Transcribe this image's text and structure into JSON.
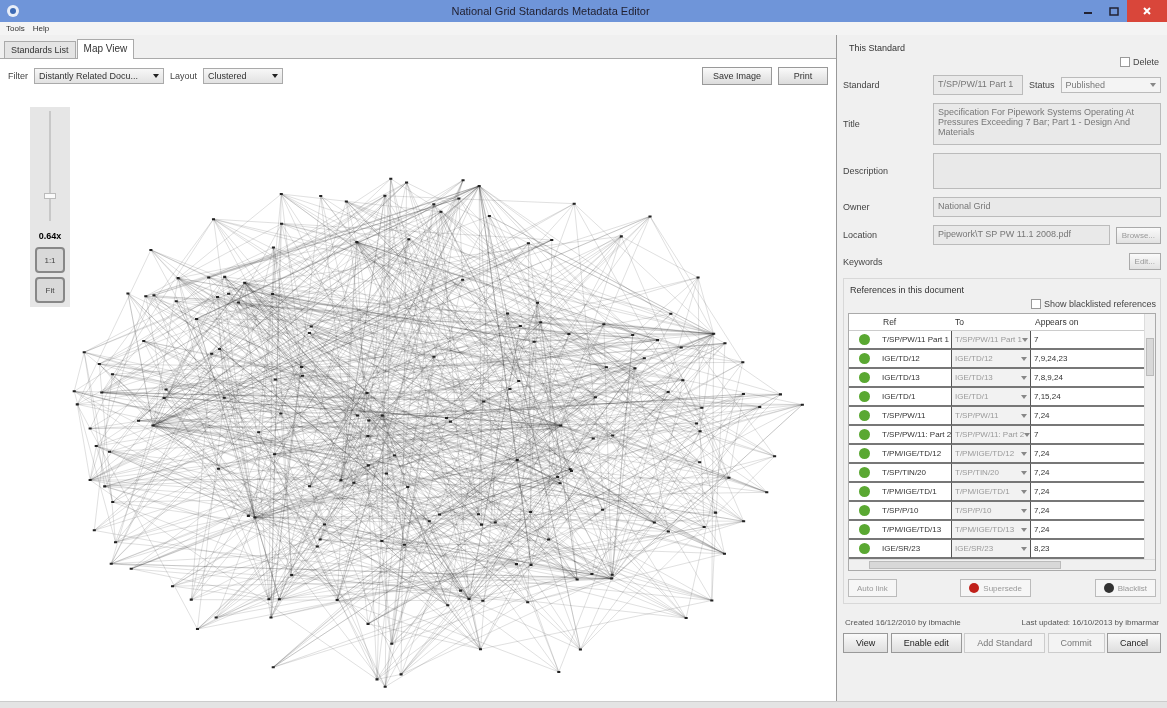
{
  "window": {
    "title": "National Grid Standards Metadata Editor"
  },
  "menu": [
    "Tools",
    "Help"
  ],
  "tabs": [
    {
      "label": "Standards List",
      "selected": false
    },
    {
      "label": "Map View",
      "selected": true
    }
  ],
  "map_toolbar": {
    "filter_label": "Filter",
    "filter_value": "Distantly Related Docu...",
    "layout_label": "Layout",
    "layout_value": "Clustered",
    "buttons": [
      "Save Image",
      "Print"
    ]
  },
  "zoom": {
    "level": 0.2,
    "reading": "0.64x",
    "buttons": [
      "1:1",
      "Fit"
    ]
  },
  "standard": {
    "group_title": "This Standard",
    "delete": {
      "label": "Delete",
      "checked": false
    },
    "fields": [
      {
        "label": "Standard",
        "value": "T/SP/PW/11 Part 1"
      },
      {
        "label": "Title",
        "value": "Specification For Pipework Systems Operating At Pressures Exceeding 7 Bar; Part 1 - Design And Materials"
      },
      {
        "label": "Description"
      },
      {
        "label": "Owner",
        "value": "National Grid"
      },
      {
        "label": "Location",
        "value": "Pipework\\T SP PW 11.1 2008.pdf"
      },
      {
        "label": "Keywords"
      }
    ],
    "status_label": "Status",
    "status_value": "Published",
    "browse_button": "Browse...",
    "edit_button": "Edit..."
  },
  "references": {
    "group_title": "References in this document",
    "show_blacklisted": {
      "label": "Show blacklisted references",
      "checked": false
    },
    "columns": [
      "Ref",
      "To",
      "Appears on"
    ],
    "rows": [
      {
        "color": "#5aa832",
        "ref": "T/SP/PW/11 Part 1",
        "to": "T/SP/PW/11 Part 1",
        "appears": "7"
      },
      {
        "color": "#5aa832",
        "ref": "IGE/TD/12",
        "to": "IGE/TD/12",
        "appears": "7,9,24,23"
      },
      {
        "color": "#5aa832",
        "ref": "IGE/TD/13",
        "to": "IGE/TD/13",
        "appears": "7,8,9,24"
      },
      {
        "color": "#5aa832",
        "ref": "IGE/TD/1",
        "to": "IGE/TD/1",
        "appears": "7,15,24"
      },
      {
        "color": "#5aa832",
        "ref": "T/SP/PW/11",
        "to": "T/SP/PW/11",
        "appears": "7,24"
      },
      {
        "color": "#5aa832",
        "ref": "T/SP/PW/11: Part 2",
        "to": "T/SP/PW/11: Part 2",
        "appears": "7"
      },
      {
        "color": "#5aa832",
        "ref": "T/PM/IGE/TD/12",
        "to": "T/PM/IGE/TD/12",
        "appears": "7,24"
      },
      {
        "color": "#5aa832",
        "ref": "T/SP/TIN/20",
        "to": "T/SP/TIN/20",
        "appears": "7,24"
      },
      {
        "color": "#5aa832",
        "ref": "T/PM/IGE/TD/1",
        "to": "T/PM/IGE/TD/1",
        "appears": "7,24"
      },
      {
        "color": "#5aa832",
        "ref": "T/SP/P/10",
        "to": "T/SP/P/10",
        "appears": "7,24"
      },
      {
        "color": "#5aa832",
        "ref": "T/PM/IGE/TD/13",
        "to": "T/PM/IGE/TD/13",
        "appears": "7,24"
      },
      {
        "color": "#5aa832",
        "ref": "IGE/SR/23",
        "to": "IGE/SR/23",
        "appears": "8,23"
      }
    ],
    "actions": [
      {
        "label": "Auto link",
        "kind": "plain"
      },
      {
        "label": "Supersede",
        "kind": "red"
      },
      {
        "label": "Blacklist",
        "kind": "black"
      }
    ]
  },
  "created": "Created 16/12/2010 by ibmachie",
  "updated": "Last updated: 16/10/2013 by ibmarmar",
  "footer_buttons": [
    {
      "label": "View",
      "disabled": false
    },
    {
      "label": "Enable edit",
      "disabled": false
    },
    {
      "label": "Add Standard",
      "disabled": true
    },
    {
      "label": "Commit",
      "disabled": true
    },
    {
      "label": "Cancel",
      "disabled": false
    }
  ]
}
